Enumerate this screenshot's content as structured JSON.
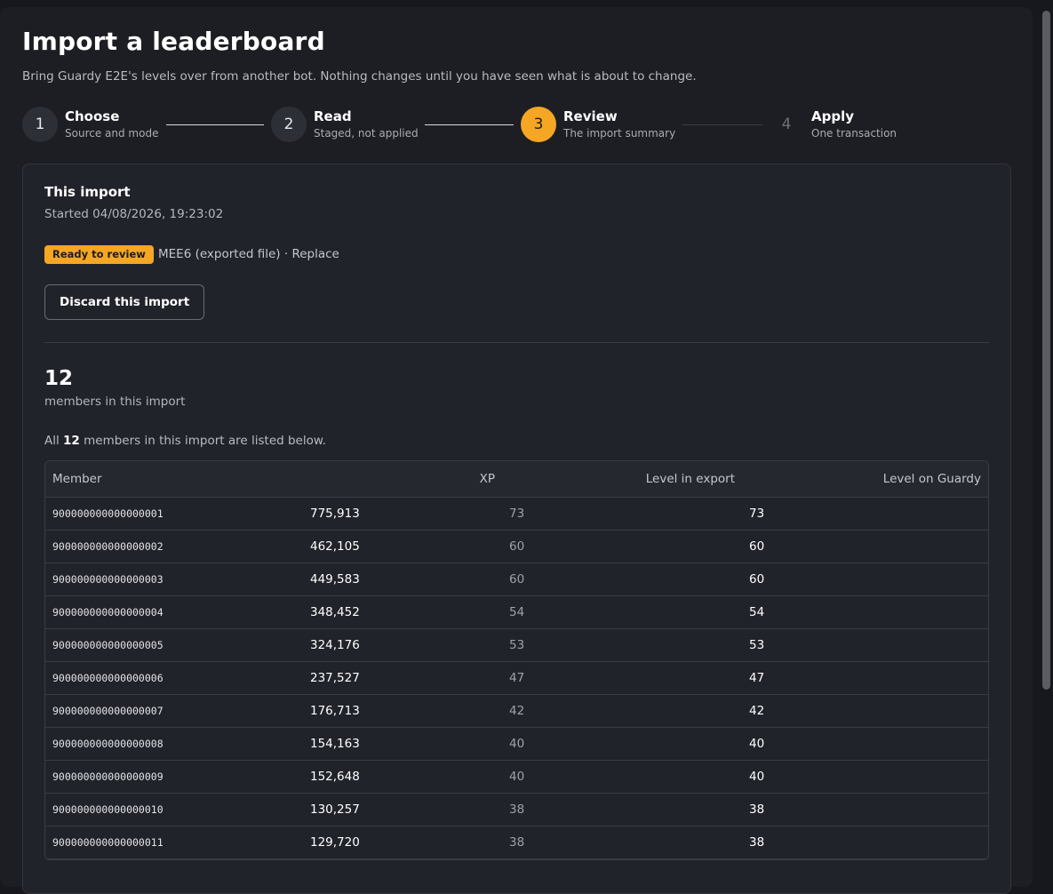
{
  "page": {
    "title": "Import a leaderboard",
    "subtitle": "Bring Guardy E2E's levels over from another bot. Nothing changes until you have seen what is about to change."
  },
  "steps": [
    {
      "num": "1",
      "title": "Choose",
      "sub": "Source and mode"
    },
    {
      "num": "2",
      "title": "Read",
      "sub": "Staged, not applied"
    },
    {
      "num": "3",
      "title": "Review",
      "sub": "The import summary"
    },
    {
      "num": "4",
      "title": "Apply",
      "sub": "One transaction"
    }
  ],
  "card": {
    "title": "This import",
    "started": "Started 04/08/2026, 19:23:02",
    "badge": "Ready to review",
    "source": "MEE6 (exported file) · Replace",
    "discard_label": "Discard this import",
    "count": "12",
    "count_label": "members in this import",
    "note_prefix": "All ",
    "note_count": "12",
    "note_suffix": " members in this import are listed below."
  },
  "colors": {
    "accent": "#f5a623",
    "background": "#17181d",
    "panel": "#1d1e24",
    "card": "#21232a"
  },
  "table": {
    "headers": {
      "member": "Member",
      "xp": "XP",
      "level_export": "Level in export",
      "level_guardy": "Level on Guardy"
    },
    "rows": [
      {
        "member": "900000000000000001",
        "xp": "775,913",
        "level_export": "73",
        "level_guardy": "73"
      },
      {
        "member": "900000000000000002",
        "xp": "462,105",
        "level_export": "60",
        "level_guardy": "60"
      },
      {
        "member": "900000000000000003",
        "xp": "449,583",
        "level_export": "60",
        "level_guardy": "60"
      },
      {
        "member": "900000000000000004",
        "xp": "348,452",
        "level_export": "54",
        "level_guardy": "54"
      },
      {
        "member": "900000000000000005",
        "xp": "324,176",
        "level_export": "53",
        "level_guardy": "53"
      },
      {
        "member": "900000000000000006",
        "xp": "237,527",
        "level_export": "47",
        "level_guardy": "47"
      },
      {
        "member": "900000000000000007",
        "xp": "176,713",
        "level_export": "42",
        "level_guardy": "42"
      },
      {
        "member": "900000000000000008",
        "xp": "154,163",
        "level_export": "40",
        "level_guardy": "40"
      },
      {
        "member": "900000000000000009",
        "xp": "152,648",
        "level_export": "40",
        "level_guardy": "40"
      },
      {
        "member": "900000000000000010",
        "xp": "130,257",
        "level_export": "38",
        "level_guardy": "38"
      },
      {
        "member": "900000000000000011",
        "xp": "129,720",
        "level_export": "38",
        "level_guardy": "38"
      }
    ]
  }
}
